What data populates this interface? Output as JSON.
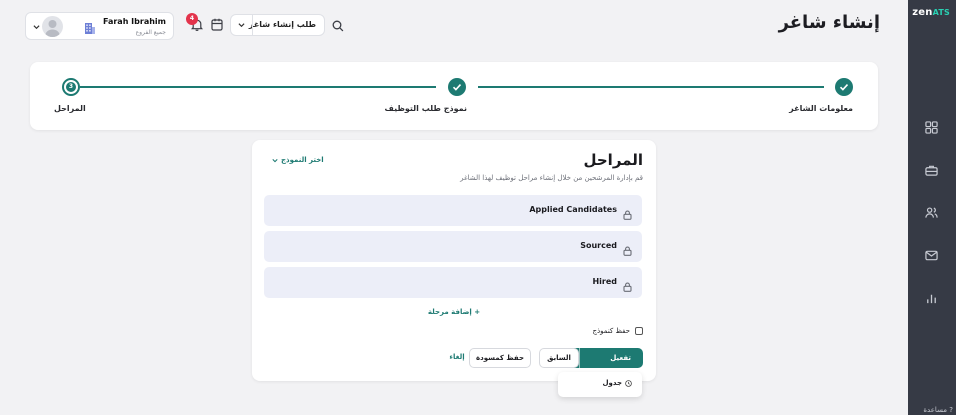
{
  "app": {
    "logo_main": "zen",
    "logo_accent": "ATS",
    "help_label": "مساعدة"
  },
  "header": {
    "title": "إنشاء شاغر",
    "request_select_value": "طلب إنشاء شاغر",
    "notification_count": "4",
    "user_name": "Farah Ibrahim",
    "user_branch": "جميع الفروع"
  },
  "stepper": {
    "steps": [
      {
        "label": "معلومات الشاغر",
        "state": "done"
      },
      {
        "label": "نموذج طلب التوظيف",
        "state": "done"
      },
      {
        "label": "المراحل",
        "number": "3",
        "state": "active"
      }
    ]
  },
  "stages": {
    "title": "المراحل",
    "subtitle": "قم بإدارة المرشحين من خلال إنشاء مراحل توظيف لهذا الشاغر",
    "template_picker_label": "اختر النموذج",
    "items": [
      {
        "label": "Applied Candidates",
        "locked": true
      },
      {
        "label": "Sourced",
        "locked": true
      },
      {
        "label": "Hired",
        "locked": true
      }
    ],
    "add_stage_label": "+ إضافة مرحلة",
    "save_as_template_label": "حفظ كنموذج",
    "save_as_template_checked": false
  },
  "actions": {
    "activate_label": "تفعيل",
    "previous_label": "السابق",
    "save_draft_label": "حفظ كمسودة",
    "cancel_label": "إلغاء",
    "dropdown_schedule_label": "جدول"
  },
  "colors": {
    "accent": "#1d7a72",
    "sidebar": "#363a45",
    "badge": "#e3334b",
    "stage_row_bg": "#eceef8"
  },
  "icons": {
    "sidebar": [
      "dashboard-icon",
      "briefcase-icon",
      "users-icon",
      "mail-icon",
      "chart-icon"
    ]
  }
}
